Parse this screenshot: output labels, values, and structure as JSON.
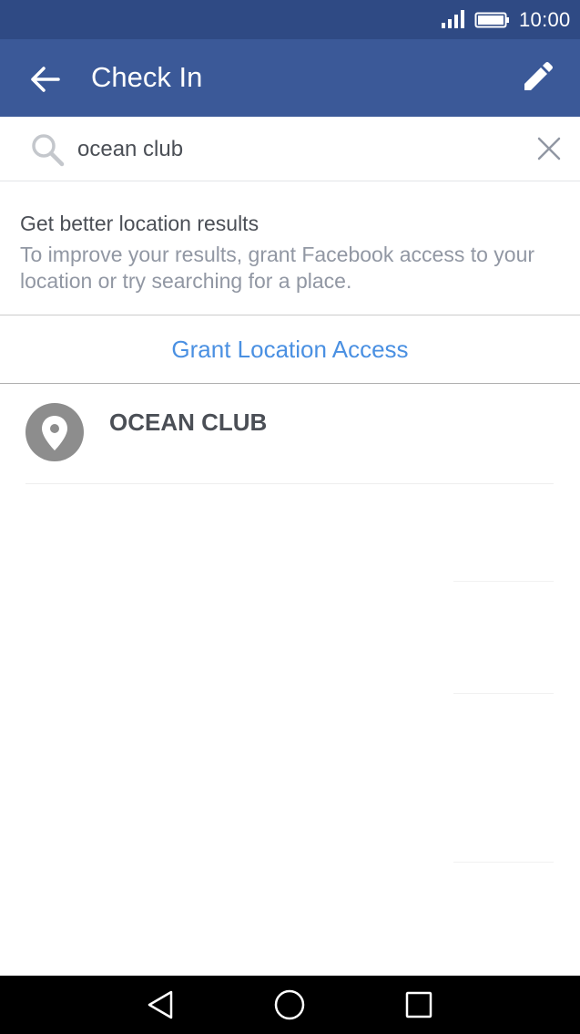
{
  "status_bar": {
    "time": "10:00",
    "signal_icon": "signal-icon",
    "battery_icon": "battery-icon",
    "color": "#2f4a84"
  },
  "app_bar": {
    "title": "Check In",
    "back_icon": "back-arrow-icon",
    "edit_icon": "pencil-icon",
    "color": "#3b5998"
  },
  "search": {
    "value": "ocean club",
    "search_icon": "search-icon",
    "clear_icon": "close-icon"
  },
  "location_prompt": {
    "heading": "Get better location results",
    "body": "To improve your results, grant Facebook access to your location or try searching for a place.",
    "button_label": "Grant Location Access",
    "button_color": "#4a90e2"
  },
  "results": [
    {
      "name": "OCEAN CLUB",
      "icon": "location-pin-icon"
    }
  ],
  "nav_bar": {
    "back_icon": "nav-back-icon",
    "home_icon": "nav-home-icon",
    "recents_icon": "nav-recents-icon"
  }
}
